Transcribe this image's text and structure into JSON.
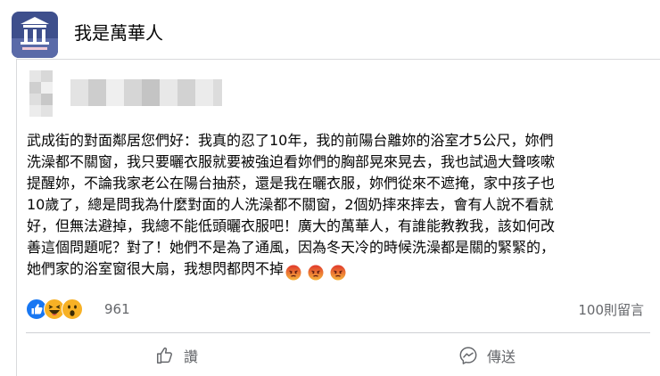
{
  "page": {
    "name": "我是萬華人"
  },
  "post": {
    "lines": [
      "武成街的對面鄰居您們好：我真的忍了10年，我的前陽台離妳的浴室才5公尺，妳們",
      "洗澡都不關窗，我只要曬衣服就要被強迫看妳們的胸部晃來晃去，我也試過大聲咳嗽",
      "提醒妳，不論我家老公在陽台抽菸，還是我在曬衣服，妳們從來不遮掩，家中孩子也",
      "10歲了，總是問我為什麼對面的人洗澡都不關窗，2個奶摔來摔去，會有人說不看就",
      "好，但無法避掉，我總不能低頭曬衣服吧！廣大的萬華人，有誰能教教我，該如何改",
      "善這個問題呢？對了！她們不是為了通風，因為冬天冷的時候洗澡都是關的緊緊的，",
      "她們家的浴室窗很大扇，我想閃都閃不掉"
    ],
    "trailing_emoji": "angry-face x3"
  },
  "reactions": {
    "icons": [
      "like-icon",
      "haha-icon",
      "wow-icon"
    ],
    "count": "961",
    "comments": "100則留言"
  },
  "actions": {
    "like_label": "讚",
    "share_label": "傳送"
  },
  "colors": {
    "like_blue": "#1877f2",
    "reaction_yellow": "#f7b125",
    "angry_red": "#e9710f",
    "muted_text": "#65676b"
  }
}
